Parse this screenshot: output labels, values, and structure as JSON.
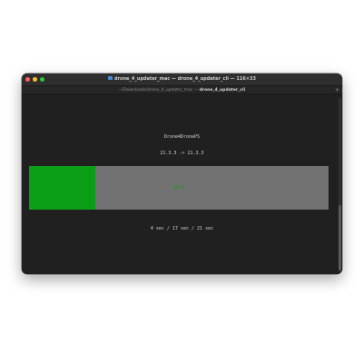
{
  "window": {
    "title": "drone_4_updater_mac — drone_4_updater_cli — 116×33",
    "tab_path": "~/Downloads/drone_4_updater_mac — ",
    "tab_current": "drone_4_updater_cli",
    "tab_add_label": "+"
  },
  "terminal": {
    "app_name": "Drone4DronePS",
    "version_line": "21.3.3 -> 21.3.3",
    "progress": {
      "percent": 22,
      "label": "22 %",
      "fill_color": "#0a9f16",
      "track_color": "#727272"
    },
    "timing": "4 sec / 17 sec / 21 sec"
  }
}
